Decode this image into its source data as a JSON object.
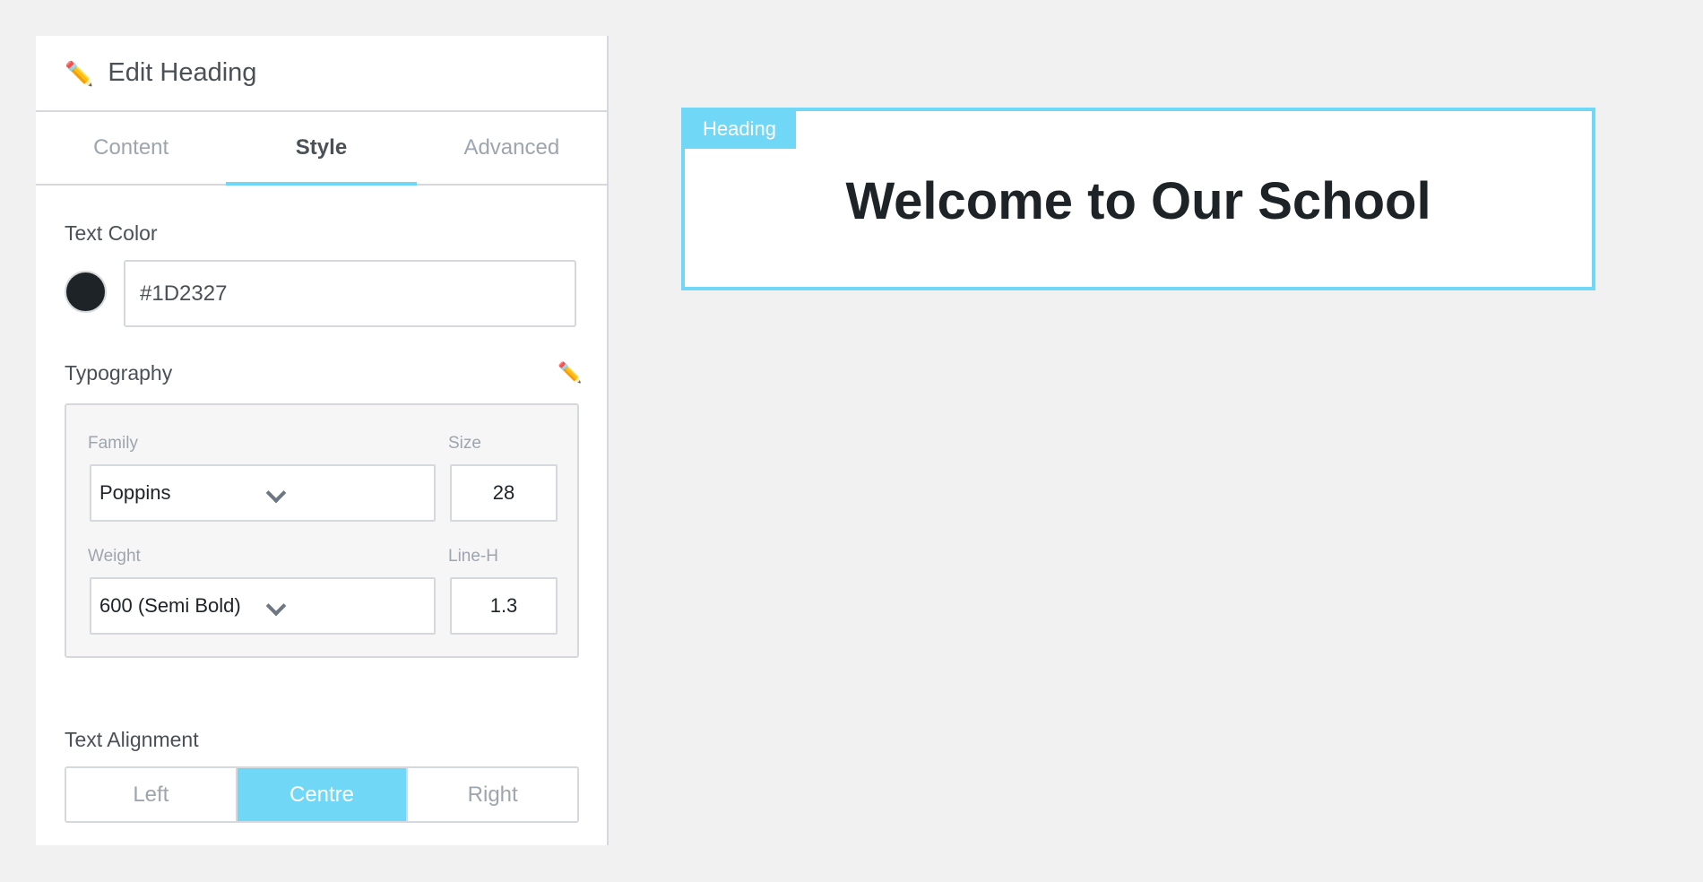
{
  "panel": {
    "title": "Edit Heading",
    "header_icon": "pencil-icon",
    "tabs": [
      {
        "label": "Content",
        "active": false
      },
      {
        "label": "Style",
        "active": true
      },
      {
        "label": "Advanced",
        "active": false
      }
    ]
  },
  "text_color": {
    "label": "Text Color",
    "value": "#1D2327",
    "swatch_color": "#1D2327"
  },
  "typography": {
    "label": "Typography",
    "edit_icon": "pencil-icon",
    "family_label": "Family",
    "family_value": "Poppins",
    "size_label": "Size",
    "size_value": "28",
    "weight_label": "Weight",
    "weight_value": "600 (Semi Bold)",
    "lineheight_label": "Line-H",
    "lineheight_value": "1.3"
  },
  "alignment": {
    "label": "Text Alignment",
    "options": [
      "Left",
      "Centre",
      "Right"
    ],
    "selected": "Centre"
  },
  "canvas": {
    "tag": "Heading",
    "heading": "Welcome to Our School"
  },
  "colors": {
    "accent": "#71d7f7",
    "text_dark": "#1D2327",
    "panel_bg": "#ffffff",
    "page_bg": "#f1f1f1"
  }
}
